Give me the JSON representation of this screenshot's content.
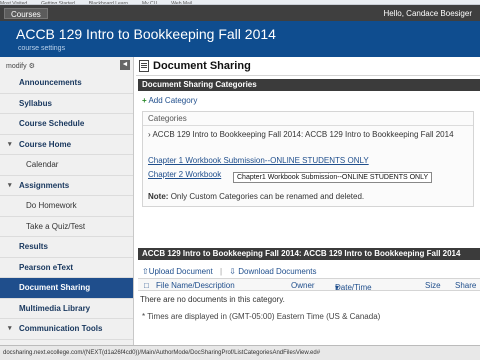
{
  "browser": {
    "bookmarks": [
      "Most Visited",
      "Getting Started",
      "Blackboard Learn",
      "My CU",
      "Web Mail"
    ],
    "status_url": "docsharing.next.ecollege.com/(NEXT(d1a26f4cd0))/Main/AuthorMode/DocSharingProf/ListCategoriesAndFilesView.ed#"
  },
  "topnav": {
    "courses_label": "Courses",
    "greeting": "Hello, Candace Boesiger"
  },
  "header": {
    "course_title": "ACCB 129 Intro to Bookkeeping Fall 2014",
    "settings_label": "course settings"
  },
  "sidebar": {
    "modify_label": "modify",
    "collapse_glyph": "◄",
    "items": [
      {
        "label": "Announcements",
        "sub": false,
        "active": false,
        "arrow": false
      },
      {
        "label": "Syllabus",
        "sub": false,
        "active": false,
        "arrow": false
      },
      {
        "label": "Course Schedule",
        "sub": false,
        "active": false,
        "arrow": false
      },
      {
        "label": "Course Home",
        "sub": false,
        "active": false,
        "arrow": true
      },
      {
        "label": "Calendar",
        "sub": true,
        "active": false,
        "arrow": false
      },
      {
        "label": "Assignments",
        "sub": false,
        "active": false,
        "arrow": true
      },
      {
        "label": "Do Homework",
        "sub": true,
        "active": false,
        "arrow": false
      },
      {
        "label": "Take a Quiz/Test",
        "sub": true,
        "active": false,
        "arrow": false
      },
      {
        "label": "Results",
        "sub": false,
        "active": false,
        "arrow": false
      },
      {
        "label": "Pearson eText",
        "sub": false,
        "active": false,
        "arrow": false
      },
      {
        "label": "Document Sharing",
        "sub": false,
        "active": true,
        "arrow": false
      },
      {
        "label": "Multimedia Library",
        "sub": false,
        "active": false,
        "arrow": false
      },
      {
        "label": "Communication Tools",
        "sub": false,
        "active": false,
        "arrow": true
      }
    ]
  },
  "main": {
    "title": "Document Sharing",
    "categories_bar": "Document Sharing Categories",
    "add_category": "Add Category",
    "categories_header": "Categories",
    "category_row1": "ACCB 129 Intro to Bookkeeping Fall 2014: ACCB 129 Intro to Bookkeeping Fall 2014",
    "category_link1": "Chapter 1 Workbook Submission--ONLINE STUDENTS ONLY",
    "category_link2": "Chapter 2 Workbook",
    "tooltip": "Chapter1 Workbook Submission--ONLINE STUDENTS ONLY",
    "note_bold": "Note:",
    "note_text": "Only Custom Categories can be renamed and deleted.",
    "files_bar": "ACCB 129 Intro to Bookkeeping Fall 2014: ACCB 129 Intro to Bookkeeping Fall 2014",
    "upload_label": "Upload Document",
    "download_label": "Download Documents",
    "columns": [
      "File Name/Description",
      "Owner",
      "Date/Time",
      "Size",
      "Share"
    ],
    "sort_indicator": "▾",
    "empty_message": "There are no documents in this category.",
    "times_note": "* Times are displayed in (GMT-05:00) Eastern Time (US & Canada)"
  }
}
